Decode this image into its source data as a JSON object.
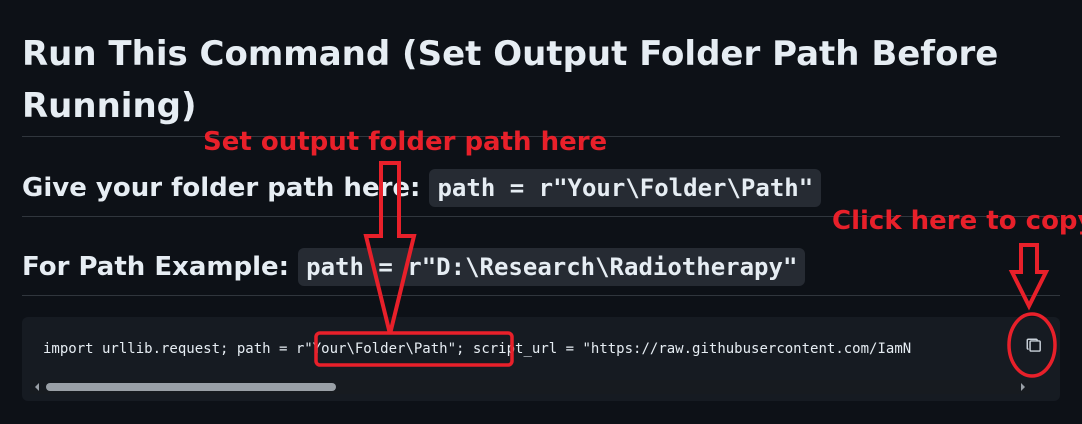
{
  "heading": {
    "line1": "Run This Command (Set Output Folder Path Before",
    "line2": "Running)"
  },
  "path_line": {
    "label": "Give your folder path here: ",
    "code": "path = r\"Your\\Folder\\Path\""
  },
  "example_line": {
    "label": "For Path Example: ",
    "code": "path = r\"D:\\Research\\Radiotherapy\""
  },
  "code_block": {
    "before": "import urllib.request; path = ",
    "highlight": "r\"Your\\Folder\\Path\"",
    "after": "; script_url = \"https://raw.githubusercontent.com/IamN",
    "copy_icon": "copy-icon"
  },
  "annotations": {
    "set_path": "Set output folder path here",
    "copy": "Click here to copy"
  },
  "colors": {
    "background": "#0d1117",
    "code_background": "#161b22",
    "inline_code_background": "#262b33",
    "annotation_red": "#e8202a",
    "text": "#e6edf3"
  }
}
